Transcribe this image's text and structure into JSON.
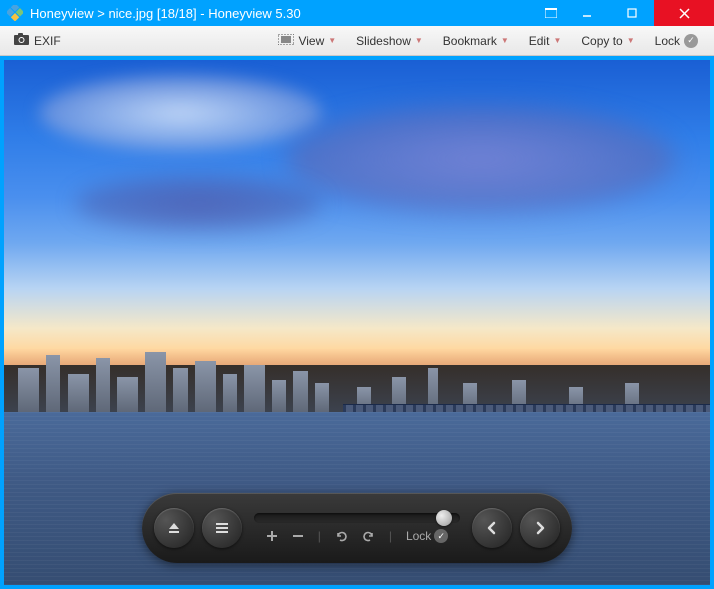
{
  "titlebar": {
    "app": "Honeyview",
    "sep": ">",
    "file": "nice.jpg",
    "index": "[18/18]",
    "dash": "-",
    "version": "Honeyview 5.30"
  },
  "toolbar": {
    "exif": "EXIF",
    "view": "View",
    "slideshow": "Slideshow",
    "bookmark": "Bookmark",
    "edit": "Edit",
    "copyto": "Copy to",
    "lock": "Lock"
  },
  "controlbar": {
    "lock": "Lock"
  }
}
